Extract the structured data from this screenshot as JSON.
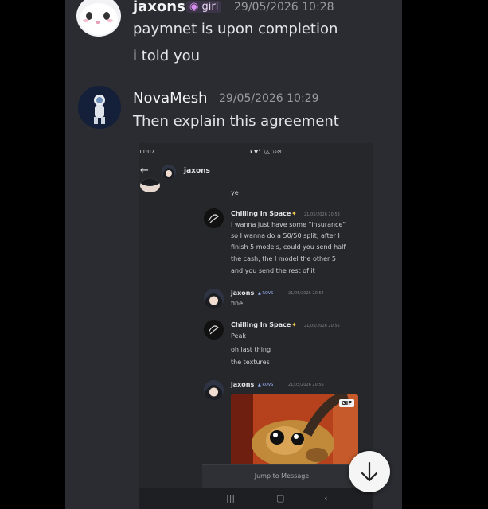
{
  "messages": [
    {
      "username": "jaxons",
      "tag": "girl",
      "timestamp": "29/05/2026 10:28",
      "lines": [
        "paymnet is upon completion",
        "i told you"
      ]
    },
    {
      "username": "NovaMesh",
      "timestamp": "29/05/2026 10:29",
      "lines": [
        "Then explain this agreement"
      ]
    }
  ],
  "screenshot": {
    "status_time": "11:07",
    "status_right": "ℹ ▼° ℷ△ ℷ⌕⊘",
    "header_user": "jaxons",
    "messages": [
      {
        "text": "ye"
      },
      {
        "username": "Chilling In Space",
        "timestamp": "21/05/2026 20:53",
        "lines": [
          "I wanna just have some \"insurance\"",
          "so I wanna do a 50/50 split, after I",
          "finish 5 models, could you send half",
          "the cash, the I model the other 5",
          "and you send the rest of it"
        ]
      },
      {
        "username": "jaxons",
        "badge": "▲ ROVS",
        "timestamp": "21/05/2026 20:54",
        "lines": [
          "fine"
        ]
      },
      {
        "username": "Chilling In Space",
        "timestamp": "21/05/2026 20:55",
        "lines": [
          "Peak",
          "oh last thing",
          "the textures"
        ]
      },
      {
        "username": "jaxons",
        "badge": "▲ ROVS",
        "timestamp": "21/05/2026 20:55",
        "gif_label": "GIF"
      }
    ],
    "jump_label": "Jump to Message"
  },
  "icons": {
    "back": "arrow-left-icon",
    "scroll_down": "arrow-down-icon"
  },
  "colors": {
    "chat_bg": "#2a2c32",
    "text": "#e3e5e8",
    "timestamp": "#9a9ca3"
  }
}
